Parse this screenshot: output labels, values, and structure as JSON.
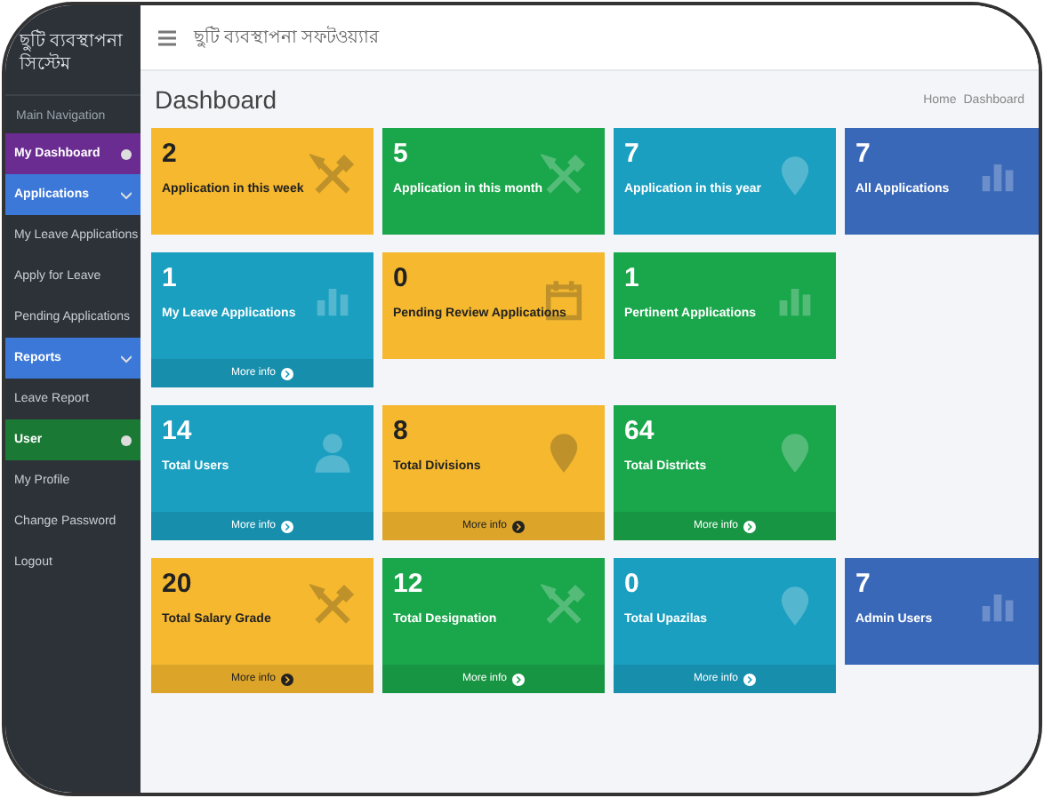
{
  "sidebar": {
    "brand": "ছুটি ব্যবস্থাপনা সিস্টেম",
    "items": [
      {
        "kind": "header",
        "label": "Main Navigation"
      },
      {
        "kind": "dot",
        "label": "My Dashboard",
        "color": "#6b2c91"
      },
      {
        "kind": "caret",
        "label": "Applications",
        "color": "#3c78d8"
      },
      {
        "kind": "item",
        "label": "My Leave Applications"
      },
      {
        "kind": "item",
        "label": "Apply for Leave"
      },
      {
        "kind": "item",
        "label": "Pending Applications"
      },
      {
        "kind": "caret",
        "label": "Reports",
        "color": "#3c78d8"
      },
      {
        "kind": "item",
        "label": "Leave Report"
      },
      {
        "kind": "dot",
        "label": "User",
        "color": "#1a7a35"
      },
      {
        "kind": "item",
        "label": "My Profile"
      },
      {
        "kind": "item",
        "label": "Change Password"
      },
      {
        "kind": "item",
        "label": "Logout"
      }
    ]
  },
  "topbar": {
    "title": "ছুটি ব্যবস্থাপনা সফটওয়্যার"
  },
  "page": {
    "title": "Dashboard",
    "breadcrumb": [
      "Home",
      "Dashboard"
    ]
  },
  "rows": [
    {
      "cards": [
        {
          "value": "2",
          "label": "Application in this week",
          "color": "#f5b82e",
          "kind": "tools"
        },
        {
          "value": "5",
          "label": "Application in this month",
          "color": "#1aa64b",
          "kind": "tools"
        },
        {
          "value": "7",
          "label": "Application in this year",
          "color": "#1a9fc0",
          "kind": "pin"
        },
        {
          "value": "7",
          "label": "All Applications",
          "color": "#3a68b8",
          "kind": "chart"
        }
      ]
    },
    {
      "cards": [
        {
          "value": "1",
          "label": "My Leave Applications",
          "color": "#1a9fc0",
          "kind": "chart",
          "footer": "More info"
        },
        {
          "value": "0",
          "label": "Pending Review Applications",
          "color": "#f5b82e",
          "kind": "calendar"
        },
        {
          "value": "1",
          "label": "Pertinent Applications",
          "color": "#1aa64b",
          "kind": "chart"
        }
      ]
    },
    {
      "cards": [
        {
          "value": "14",
          "label": "Total Users",
          "color": "#1a9fc0",
          "kind": "user",
          "footer": "More info"
        },
        {
          "value": "8",
          "label": "Total Divisions",
          "color": "#f5b82e",
          "kind": "pin",
          "footer": "More info"
        },
        {
          "value": "64",
          "label": "Total Districts",
          "color": "#1aa64b",
          "kind": "pin",
          "footer": "More info"
        }
      ]
    },
    {
      "cards": [
        {
          "value": "20",
          "label": "Total Salary Grade",
          "color": "#f5b82e",
          "kind": "tools",
          "footer": "More info"
        },
        {
          "value": "12",
          "label": "Total Designation",
          "color": "#1aa64b",
          "kind": "tools",
          "footer": "More info"
        },
        {
          "value": "0",
          "label": "Total Upazilas",
          "color": "#1a9fc0",
          "kind": "pin",
          "footer": "More info"
        },
        {
          "value": "7",
          "label": "Admin Users",
          "color": "#3a68b8",
          "kind": "chart"
        }
      ]
    }
  ]
}
